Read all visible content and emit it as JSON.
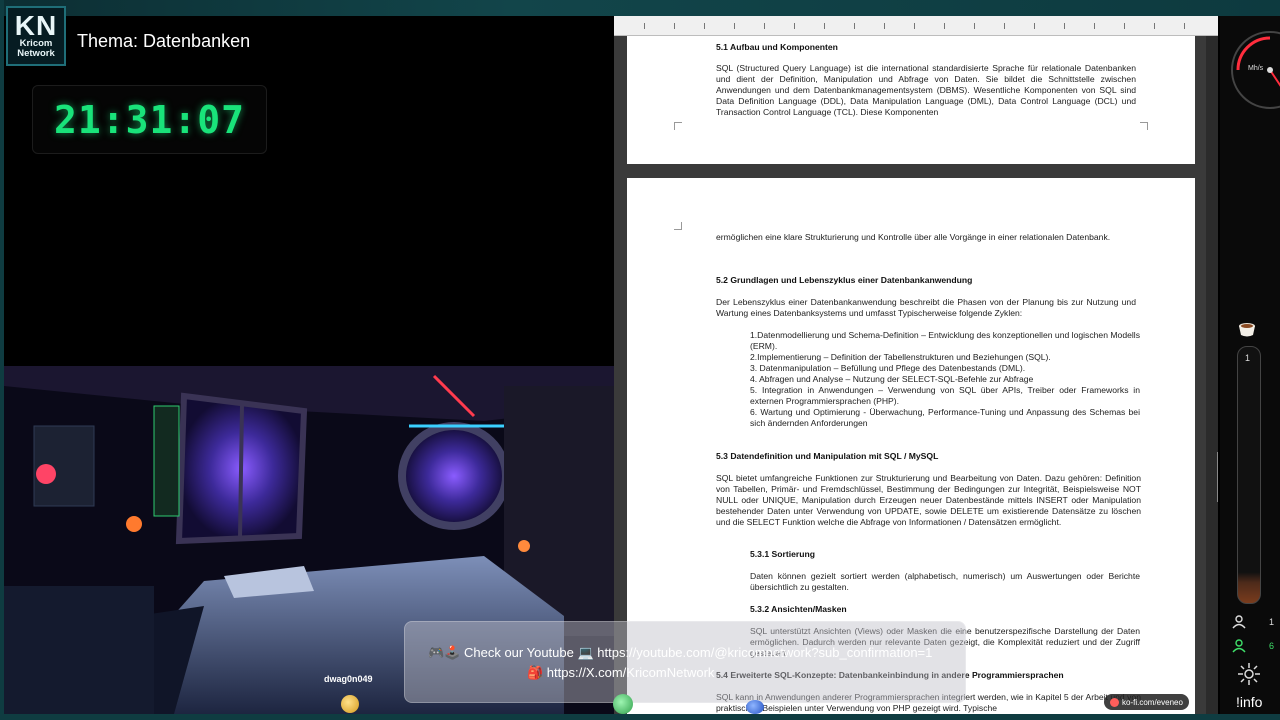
{
  "brand": {
    "logo_main": "KN",
    "logo_line1": "Kricom",
    "logo_line2": "Network"
  },
  "topic": "Thema: Datenbanken",
  "clock": "21:31:07",
  "document": {
    "page1": {
      "heading": "5.1 Aufbau und Komponenten",
      "paragraph": "SQL (Structured Query Language) ist die international standardisierte Sprache für relationale Datenbanken und dient der Definition, Manipulation und Abfrage von Daten. Sie bildet die Schnittstelle zwischen Anwendungen und dem Datenbankmanagementsystem (DBMS). Wesentliche Komponenten von SQL sind Data Definition Language (DDL), Data Manipulation Language (DML), Data Control Language (DCL) und Transaction Control Language (TCL). Diese Komponenten"
    },
    "page2": {
      "continuation": "ermöglichen eine klare Strukturierung und Kontrolle über alle Vorgänge in einer relationalen Datenbank.",
      "h52": "5.2 Grundlagen und Lebenszyklus einer Datenbankanwendung",
      "p52": "Der Lebenszyklus einer Datenbankanwendung beschreibt die Phasen von der Planung bis zur Nutzung und Wartung eines Datenbanksystems und umfasst Typischerweise folgende Zyklen:",
      "list": [
        "1.Datenmodellierung und Schema-Definition – Entwicklung des konzeptionellen und logischen Modells (ERM).",
        "2.Implementierung – Definition der Tabellenstrukturen und Beziehungen (SQL).",
        "3. Datenmanipulation – Befüllung und Pflege des Datenbestands (DML).",
        "4. Abfragen und Analyse – Nutzung der SELECT-SQL-Befehle zur Abfrage",
        "5. Integration in Anwendungen – Verwendung von SQL über APIs, Treiber oder Frameworks in externen Programmiersprachen (PHP).",
        "6. Wartung und Optimierung - Überwachung, Performance-Tuning und Anpassung des Schemas bei sich ändernden Anforderungen"
      ],
      "h53": "5.3 Datendefinition und Manipulation mit SQL / MySQL",
      "p53": "SQL bietet umfangreiche Funktionen zur Strukturierung und Bearbeitung von Daten. Dazu gehören: Definition von Tabellen, Primär- und Fremdschlüssel, Bestimmung der Bedingungen zur Integrität, Beispielsweise NOT NULL oder UNIQUE, Manipulation durch Erzeugen neuer Datenbestände mittels INSERT oder Manipulation bestehender Daten unter Verwendung von UPDATE, sowie DELETE um existierende Datensätze zu löschen und die SELECT Funktion welche die Abfrage von Informationen / Datensätzen ermöglicht.",
      "h531": "5.3.1 Sortierung",
      "p531": "Daten können gezielt sortiert werden (alphabetisch, numerisch) um Auswertungen oder Berichte übersichtlich zu gestalten.",
      "h532": "5.3.2 Ansichten/Masken",
      "p532": "SQL unterstützt Ansichten (Views) oder Masken die eine benutzerspezifische Darstellung der Daten ermöglichen. Dadurch werden nur relevante Daten gezeigt, die Komplexität reduziert und der Zugriff gesteuert.",
      "h54": "5.4 Erweiterte SQL-Konzepte: Datenbankeinbindung in andere Programmiersprachen",
      "p54": "SQL kann in Anwendungen anderer Programmiersprachen integriert werden, wie in Kapitel 5 der Arbeit und von praktischen Beispielen unter Verwendung von PHP gezeigt wird. Typische"
    }
  },
  "side_panel": {
    "gauge_label": "Mh/s",
    "tube_value": "1",
    "viewer_count": "1",
    "follower_count": "6",
    "info_label": "!info"
  },
  "banner": {
    "line1": "🎮🕹️ Check our Youtube 💻 https://youtube.com/@kricomnetwork?sub_confirmation=1",
    "line2": "🎒 https://X.com/KricomNetwork"
  },
  "chat": {
    "username": "dwag0n049"
  },
  "kofi": "ko-fi.com/eveneo",
  "colors": {
    "clock": "#19e37a",
    "frame": "#0f3c41",
    "accent": "#1f6e78"
  }
}
